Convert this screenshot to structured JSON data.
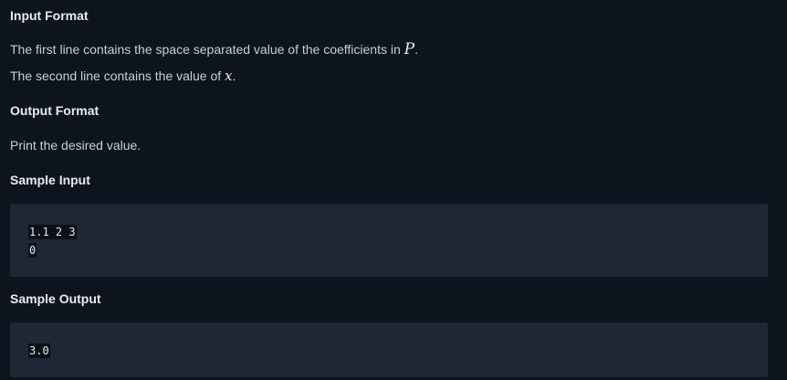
{
  "input_format": {
    "heading": "Input Format",
    "line1_text": "The first line contains the space separated value of the coefficients in ",
    "line1_var": "P",
    "line1_end": ".",
    "line2_text": "The second line contains the value of ",
    "line2_var": "x",
    "line2_end": "."
  },
  "output_format": {
    "heading": "Output Format",
    "text": "Print the desired value."
  },
  "sample_input": {
    "heading": "Sample Input",
    "lines": [
      "1.1 2 3",
      "0"
    ]
  },
  "sample_output": {
    "heading": "Sample Output",
    "lines": [
      "3.0"
    ]
  }
}
